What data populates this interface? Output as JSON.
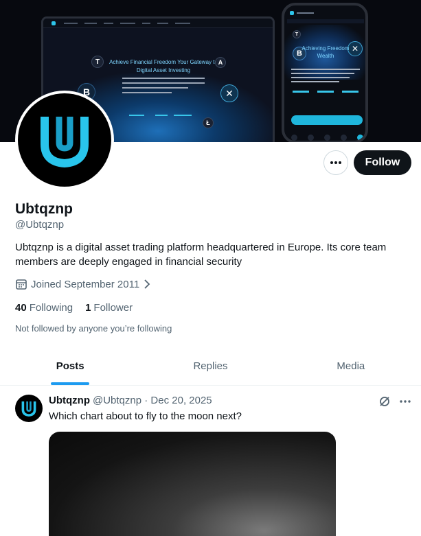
{
  "banner": {
    "headline": "Achieve Financial Freedom Your Gateway to Digital Asset Investing",
    "phone_title": "Achieving Freedom Wealth"
  },
  "profile": {
    "name": "Ubtqznp",
    "handle": "@Ubtqznp",
    "bio": "Ubtqznp is a digital asset trading platform headquartered in Europe. Its core team members are deeply engaged in financial security",
    "joined": "Joined September 2011",
    "following_count": "40",
    "following_label": "Following",
    "followers_count": "1",
    "followers_label": "Follower",
    "not_followed": "Not followed by anyone you’re following"
  },
  "actions": {
    "follow_label": "Follow"
  },
  "tabs": [
    {
      "label": "Posts",
      "active": true
    },
    {
      "label": "Replies",
      "active": false
    },
    {
      "label": "Media",
      "active": false
    }
  ],
  "post": {
    "author": "Ubtqznp",
    "meta": "@Ubtqznp · Dec 20, 2025",
    "text": "Which chart about to fly to the moon next?"
  },
  "colors": {
    "brand_cyan": "#2ec5ea",
    "follow_button": "#0f1419",
    "tab_indicator": "#1d9bf0",
    "secondary_text": "#536471"
  },
  "icons": {
    "more": "more-horizontal-icon",
    "calendar": "calendar-icon",
    "chevron": "chevron-right-icon",
    "grok": "grok-icon"
  }
}
